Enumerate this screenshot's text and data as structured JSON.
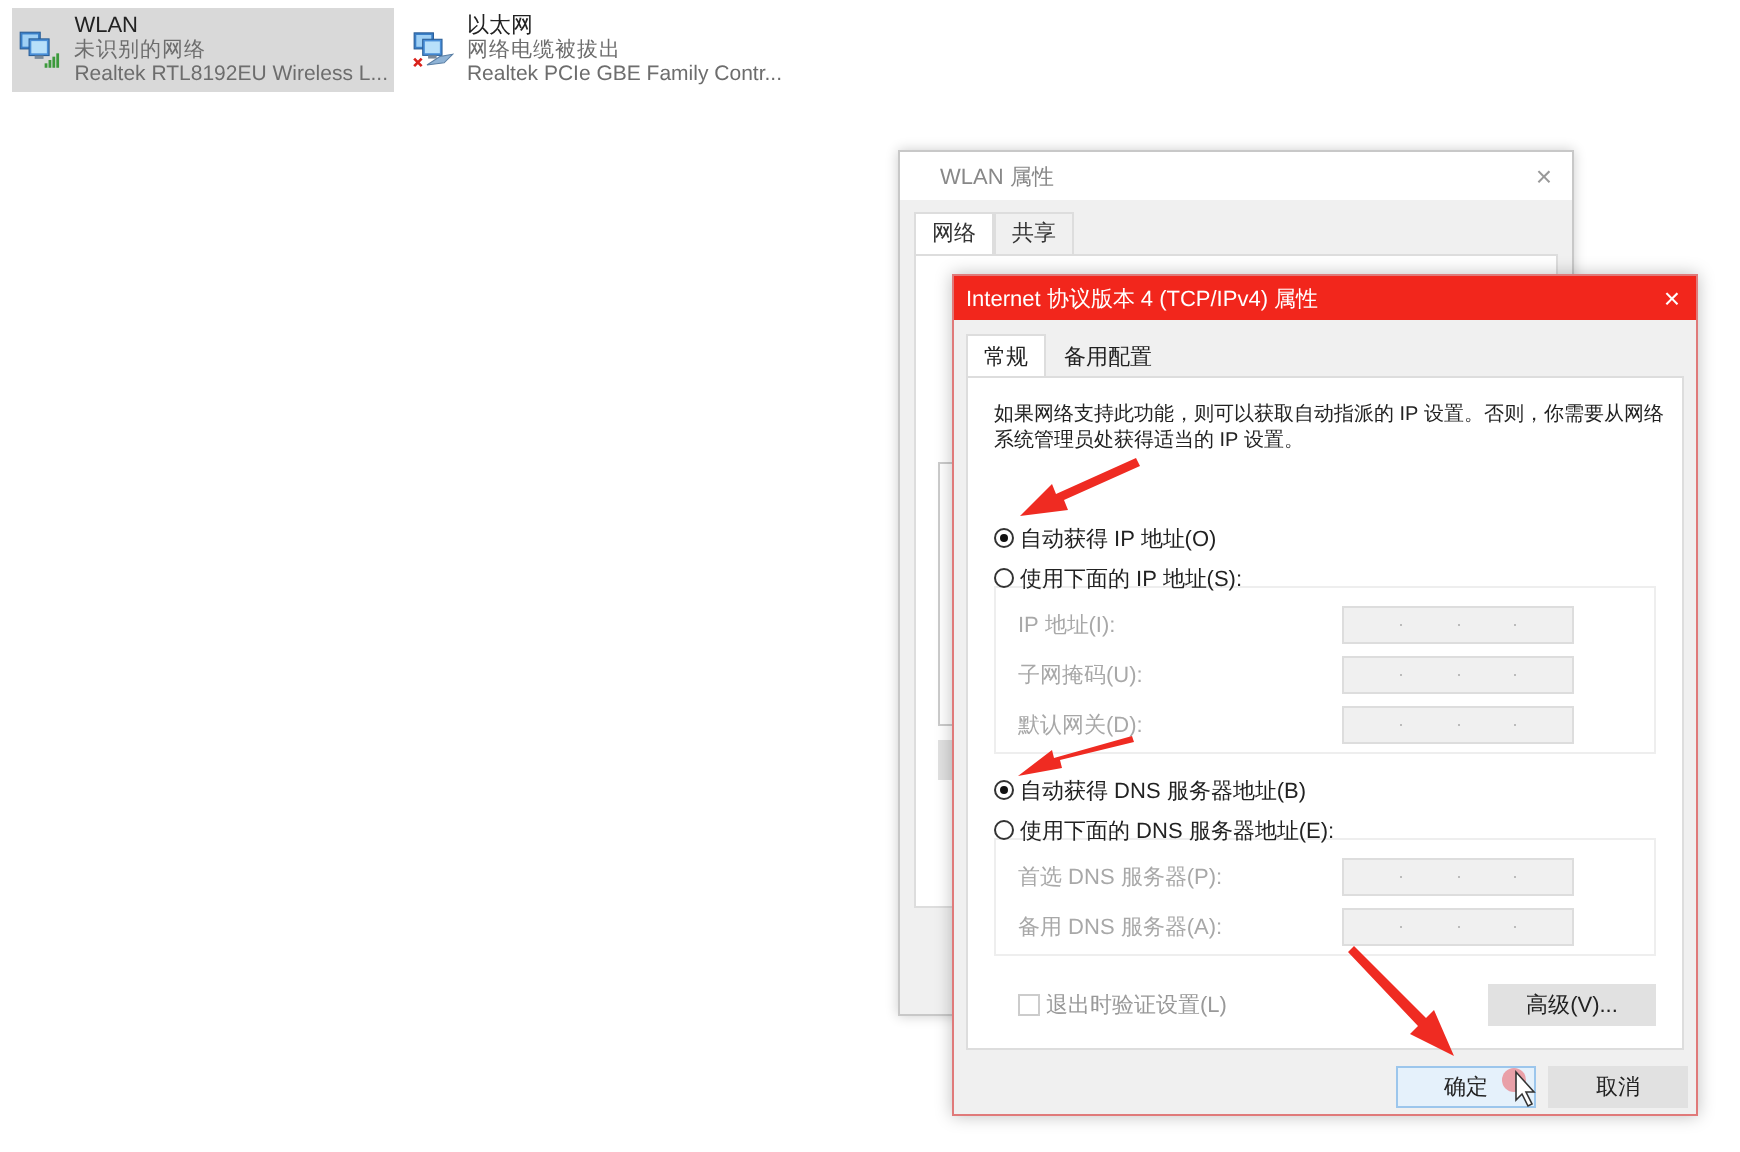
{
  "adapters": [
    {
      "name": "WLAN",
      "status": "未识别的网络",
      "device": "Realtek RTL8192EU Wireless L...",
      "kind": "wireless",
      "selected": true
    },
    {
      "name": "以太网",
      "status": "网络电缆被拔出",
      "device": "Realtek PCIe GBE Family Contr...",
      "kind": "ethernet",
      "selected": false
    }
  ],
  "back_window": {
    "title": "WLAN 属性",
    "close": "×",
    "tabs": [
      {
        "label": "网络",
        "selected": true
      },
      {
        "label": "共享",
        "selected": false
      }
    ]
  },
  "dialog": {
    "title": "Internet 协议版本 4 (TCP/IPv4) 属性",
    "close": "×",
    "tabs": [
      {
        "label": "常规",
        "selected": true
      },
      {
        "label": "备用配置",
        "selected": false
      }
    ],
    "intro": "如果网络支持此功能，则可以获取自动指派的 IP 设置。否则，你需要从网络系统管理员处获得适当的 IP 设置。",
    "ip_options": [
      {
        "label": "自动获得 IP 地址(O)",
        "selected": true
      },
      {
        "label": "使用下面的 IP 地址(S):",
        "selected": false
      }
    ],
    "ip_fields": [
      {
        "label": "IP 地址(I):",
        "disabled": true
      },
      {
        "label": "子网掩码(U):",
        "disabled": true
      },
      {
        "label": "默认网关(D):",
        "disabled": true
      }
    ],
    "dns_options": [
      {
        "label": "自动获得 DNS 服务器地址(B)",
        "selected": true
      },
      {
        "label": "使用下面的 DNS 服务器地址(E):",
        "selected": false
      }
    ],
    "dns_fields": [
      {
        "label": "首选 DNS 服务器(P):",
        "disabled": true
      },
      {
        "label": "备用 DNS 服务器(A):",
        "disabled": true
      }
    ],
    "validate": {
      "label": "退出时验证设置(L)",
      "checked": false,
      "disabled": true
    },
    "advanced": "高级(V)...",
    "buttons": [
      {
        "label": "确定",
        "kind": "default"
      },
      {
        "label": "取消",
        "kind": "normal"
      }
    ]
  }
}
